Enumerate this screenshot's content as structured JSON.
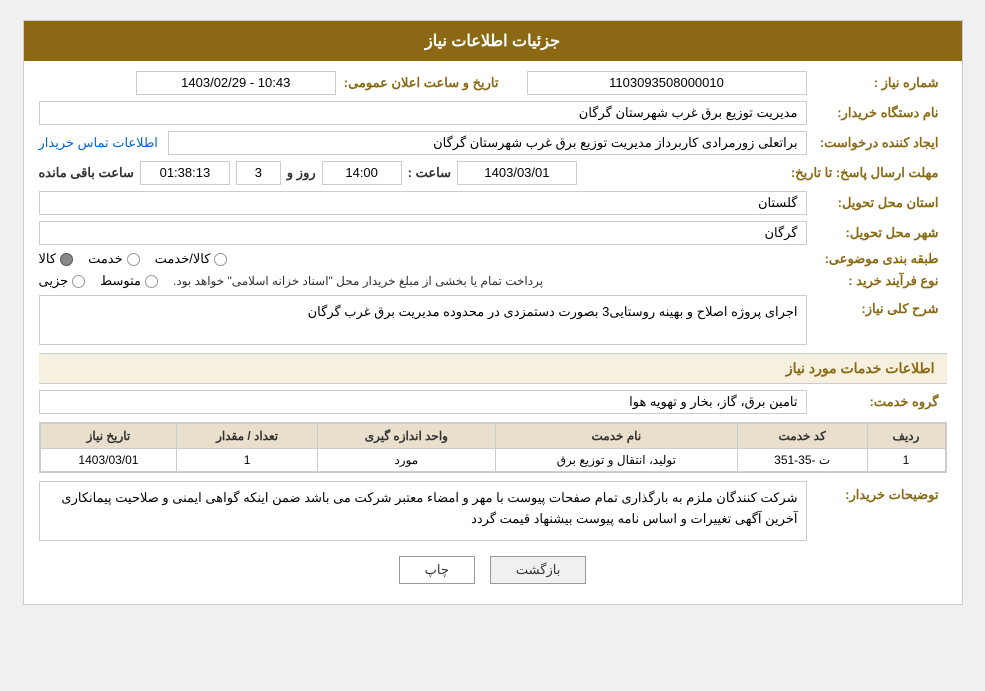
{
  "header": {
    "title": "جزئیات اطلاعات نیاز"
  },
  "fields": {
    "need_number_label": "شماره نیاز :",
    "need_number_value": "1103093508000010",
    "buyer_org_label": "نام دستگاه خریدار:",
    "buyer_org_value": "مدیریت توزیع برق غرب شهرستان گرگان",
    "creator_label": "ایجاد کننده درخواست:",
    "creator_value": "براتعلی زورمرادی کاربرداز مدیریت توزیع برق غرب شهرستان گرگان",
    "contact_info_link": "اطلاعات تماس خریدار",
    "deadline_label": "مهلت ارسال پاسخ: تا تاریخ:",
    "deadline_date": "1403/03/01",
    "deadline_time_label": "ساعت :",
    "deadline_time": "14:00",
    "deadline_days_label": "روز و",
    "deadline_days": "3",
    "deadline_remaining_label": "ساعت باقی مانده",
    "deadline_remaining": "01:38:13",
    "announce_label": "تاریخ و ساعت اعلان عمومی:",
    "announce_value": "1403/02/29 - 10:43",
    "province_label": "استان محل تحویل:",
    "province_value": "گلستان",
    "city_label": "شهر محل تحویل:",
    "city_value": "گرگان",
    "category_label": "طبقه بندی موضوعی:",
    "category_options": [
      "کالا",
      "خدمت",
      "کالا/خدمت"
    ],
    "category_selected": "کالا",
    "purchase_type_label": "نوع فرآیند خرید :",
    "purchase_options": [
      "جزیی",
      "متوسط"
    ],
    "purchase_note": "پرداخت تمام یا بخشی از مبلغ خریدار محل \"اسناد خزانه اسلامی\" خواهد بود.",
    "need_desc_label": "شرح کلی نیاز:",
    "need_desc_value": "اجرای پروژه اصلاح و بهینه روستایی3 بصورت دستمزدی در محدوده مدیریت برق غرب گرگان"
  },
  "services_section": {
    "title": "اطلاعات خدمات مورد نیاز",
    "service_group_label": "گروه خدمت:",
    "service_group_value": "تامین برق، گاز، بخار و تهویه هوا"
  },
  "table": {
    "columns": [
      "ردیف",
      "کد خدمت",
      "نام خدمت",
      "واحد اندازه گیری",
      "تعداد / مقدار",
      "تاریخ نیاز"
    ],
    "rows": [
      {
        "row_num": "1",
        "service_code": "ت -35-351",
        "service_name": "تولید، انتقال و توزیع برق",
        "unit": "مورد",
        "quantity": "1",
        "date": "1403/03/01"
      }
    ]
  },
  "buyer_notes_label": "توضیحات خریدار:",
  "buyer_notes_value": "شرکت کنندگان ملزم به بارگذاری تمام صفحات پیوست با مهر و امضاء معتبر شرکت می باشد ضمن اینکه گواهی ایمنی و صلاحیت پیمانکاری آخرین آگهی تغییرات و اساس نامه پیوست بیشنهاد قیمت گردد",
  "buttons": {
    "print_label": "چاپ",
    "back_label": "بازگشت"
  }
}
